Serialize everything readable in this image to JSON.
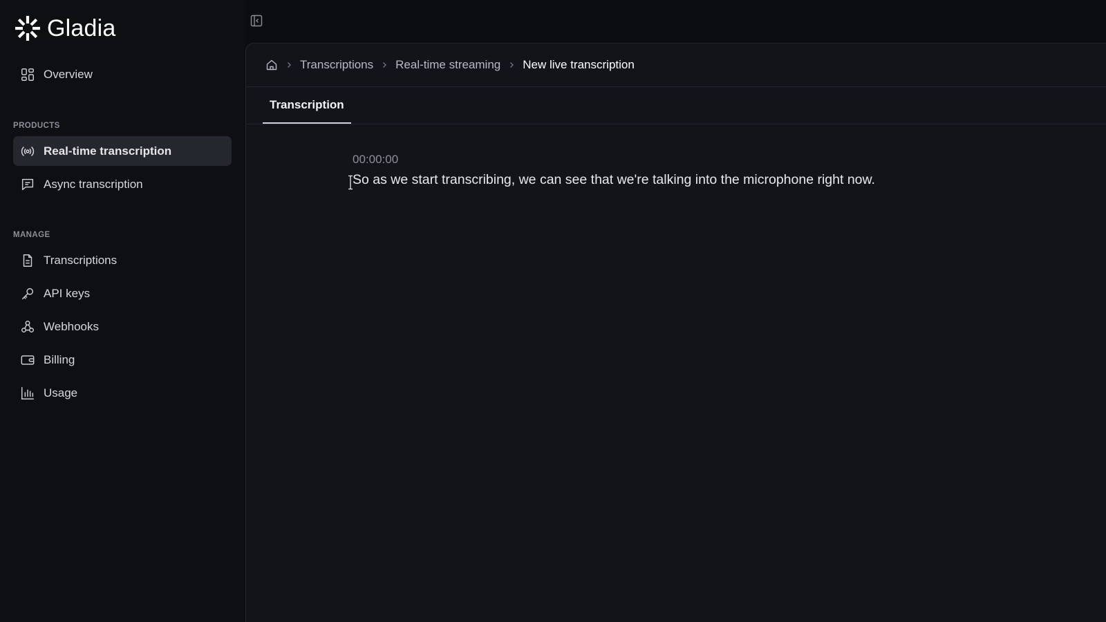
{
  "app": {
    "name": "Gladia"
  },
  "sidebar": {
    "overview": {
      "label": "Overview",
      "icon": "overview-icon"
    },
    "sections": [
      {
        "title": "PRODUCTS"
      },
      {
        "title": "MANAGE"
      }
    ],
    "products": [
      {
        "label": "Real-time transcription",
        "icon": "broadcast-icon",
        "active": true
      },
      {
        "label": "Async transcription",
        "icon": "chat-icon",
        "active": false
      }
    ],
    "manage": [
      {
        "label": "Transcriptions",
        "icon": "document-icon"
      },
      {
        "label": "API keys",
        "icon": "key-icon"
      },
      {
        "label": "Webhooks",
        "icon": "webhook-icon"
      },
      {
        "label": "Billing",
        "icon": "wallet-icon"
      },
      {
        "label": "Usage",
        "icon": "bar-chart-icon"
      }
    ]
  },
  "breadcrumb": {
    "items": [
      "Transcriptions",
      "Real-time streaming"
    ],
    "current": "New live transcription"
  },
  "tabs": [
    {
      "label": "Transcription",
      "active": true
    }
  ],
  "transcript": {
    "timestamp": "00:00:00",
    "text": "So as we start transcribing, we can see that we're talking into the microphone right now."
  },
  "colors": {
    "background": "#0c0d10",
    "sidebar": "#0e0f13",
    "panel": "#12141a",
    "active_item": "#25272e",
    "muted_text": "#8d9098"
  }
}
